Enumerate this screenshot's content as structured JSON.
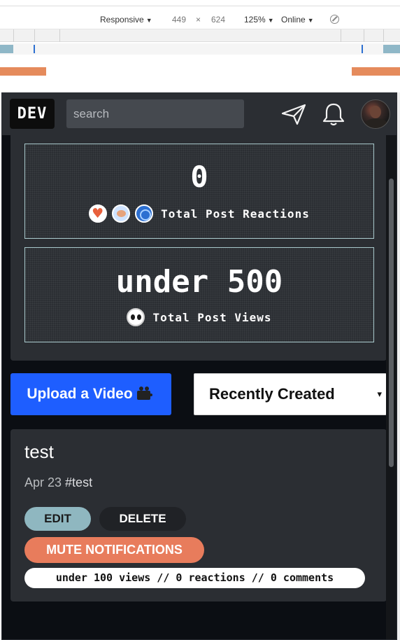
{
  "devtools": {
    "device": "Responsive",
    "width": "449",
    "times": "×",
    "height": "624",
    "zoom": "125%",
    "throttle": "Online"
  },
  "navbar": {
    "logo": "DEV",
    "search_placeholder": "search",
    "icons": [
      "send-icon",
      "bell-icon"
    ]
  },
  "stats": {
    "reactions": {
      "value": "0",
      "label": "Total Post Reactions",
      "icons": [
        "heart-emoji-icon",
        "unicorn-emoji-icon",
        "saved-emoji-icon"
      ]
    },
    "views": {
      "value": "under 500",
      "label": "Total Post Views",
      "icons": [
        "eyes-emoji-icon"
      ]
    }
  },
  "actions": {
    "upload_label": "Upload a Video",
    "sort_selected": "Recently Created",
    "sort_caret": "▾"
  },
  "posts": [
    {
      "title": "test",
      "date": "Apr 23",
      "tag": "#test",
      "edit_label": "EDIT",
      "delete_label": "DELETE",
      "mute_label": "MUTE NOTIFICATIONS",
      "stats": "under 100 views // 0 reactions // 0 comments"
    }
  ],
  "colors": {
    "accent": "#1e5eff",
    "card": "#2b2e33",
    "stat_border": "#a9c9cc",
    "edit_bg": "#8fb7c0",
    "mute_bg": "#e87c5c"
  }
}
